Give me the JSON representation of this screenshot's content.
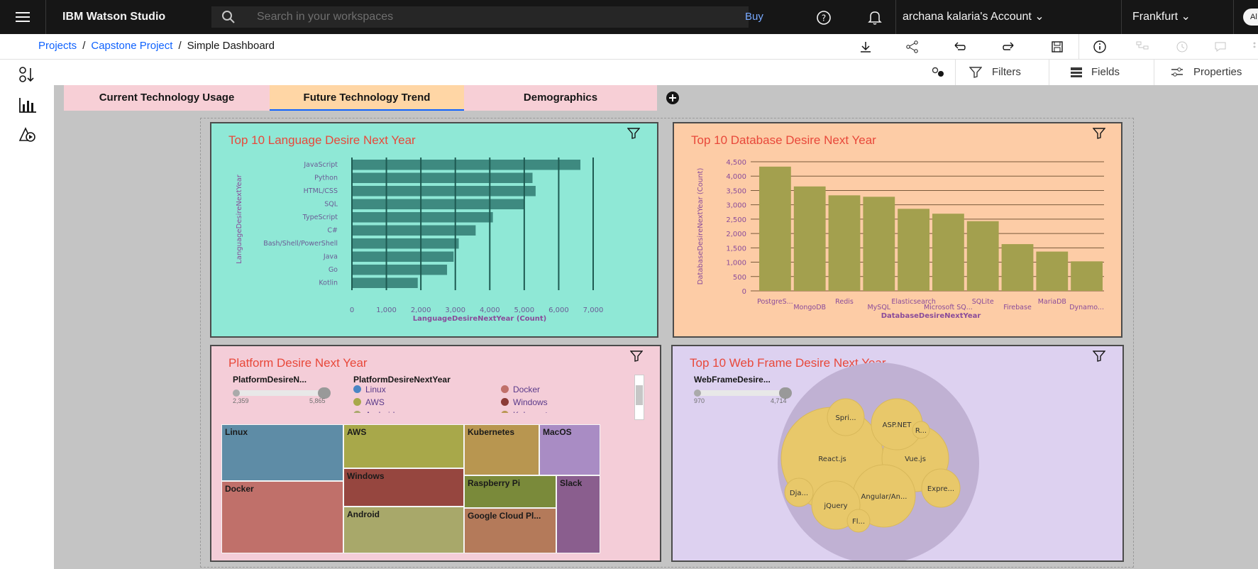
{
  "topbar": {
    "brand": "IBM Watson Studio",
    "search_placeholder": "Search in your workspaces",
    "buy": "Buy",
    "account": "archana kalaria's Account",
    "region": "Frankfurt",
    "avatar": "Al"
  },
  "breadcrumb": {
    "items": [
      "Projects",
      "Capstone Project",
      "Simple Dashboard"
    ],
    "sep": "/"
  },
  "toolbar2": {
    "filters": "Filters",
    "fields": "Fields",
    "properties": "Properties"
  },
  "tabs": [
    "Current Technology Usage",
    "Future Technology Trend",
    "Demographics"
  ],
  "colors": {
    "accent": "#0f62fe",
    "title_red": "#e8483a"
  },
  "language_chart": {
    "title": "Top 10 Language Desire Next Year",
    "chart_data": {
      "type": "bar",
      "orientation": "horizontal",
      "categories": [
        "JavaScript",
        "Python",
        "HTML/CSS",
        "SQL",
        "TypeScript",
        "C#",
        "Bash/Shell/PowerShell",
        "Java",
        "Go",
        "Kotlin"
      ],
      "values": [
        6630,
        5240,
        5330,
        4990,
        4090,
        3590,
        3100,
        2950,
        2760,
        1910
      ],
      "xlim": [
        0,
        7000
      ],
      "ticks": [
        "0",
        "1,000",
        "2,000",
        "3,000",
        "4,000",
        "5,000",
        "6,000",
        "7,000"
      ],
      "xlabel": "LanguageDesireNextYear (Count)",
      "ylabel": "LanguageDesireNextYear"
    }
  },
  "database_chart": {
    "title": "Top 10 Database Desire Next Year",
    "chart_data": {
      "type": "bar",
      "categories": [
        "PostgreS...",
        "MongoDB",
        "Redis",
        "MySQL",
        "Elasticsearch",
        "Microsoft SQ...",
        "SQLite",
        "Firebase",
        "MariaDB",
        "Dynamo..."
      ],
      "values": [
        4330,
        3640,
        3330,
        3280,
        2860,
        2690,
        2430,
        1630,
        1370,
        1030
      ],
      "ylim": [
        0,
        4500
      ],
      "ticks": [
        "0",
        "500",
        "1,000",
        "1,500",
        "2,000",
        "2,500",
        "3,000",
        "3,500",
        "4,000",
        "4,500"
      ],
      "xlabel": "DatabaseDesireNextYear",
      "ylabel": "DatabaseDesireNextYear (Count)"
    }
  },
  "platform_chart": {
    "title": "Platform Desire Next Year",
    "slider_label": "PlatformDesireN...",
    "slider_min": "2,359",
    "slider_max": "5,865",
    "legend_title": "PlatformDesireNextYear",
    "legend": [
      {
        "label": "Linux",
        "color": "#4a85c4"
      },
      {
        "label": "Docker",
        "color": "#c0706a"
      },
      {
        "label": "AWS",
        "color": "#a8a84a"
      },
      {
        "label": "Windows",
        "color": "#8b3a36"
      },
      {
        "label": "Android",
        "color": "#a8a86a"
      },
      {
        "label": "Kubernetes",
        "color": "#b89650"
      },
      {
        "label": "MacOS",
        "color": "#a98cc4"
      },
      {
        "label": "Raspberry Pi",
        "color": "#7a8a3a"
      }
    ],
    "chart_data": {
      "type": "treemap",
      "categories": [
        "Linux",
        "Docker",
        "AWS",
        "Windows",
        "Android",
        "Kubernetes",
        "MacOS",
        "Raspberry Pi",
        "Slack",
        "Google Cloud Pl..."
      ],
      "labels": [
        "Linux",
        "Docker",
        "AWS",
        "Windows",
        "Android",
        "Kubernetes",
        "MacOS",
        "Raspberry Pi",
        "Slack",
        "Google Cloud Pl..."
      ]
    }
  },
  "webframe_chart": {
    "title": "Top 10 Web Frame Desire Next Year",
    "slider_label": "WebFrameDesire...",
    "slider_min": "970",
    "slider_max": "4,714",
    "chart_data": {
      "type": "bubble",
      "labels": [
        "React.js",
        "Vue.js",
        "Angular/An...",
        "ASP.NET",
        "jQuery",
        "Spri...",
        "Expre...",
        "Dja...",
        "R...",
        "Fl..."
      ]
    }
  }
}
